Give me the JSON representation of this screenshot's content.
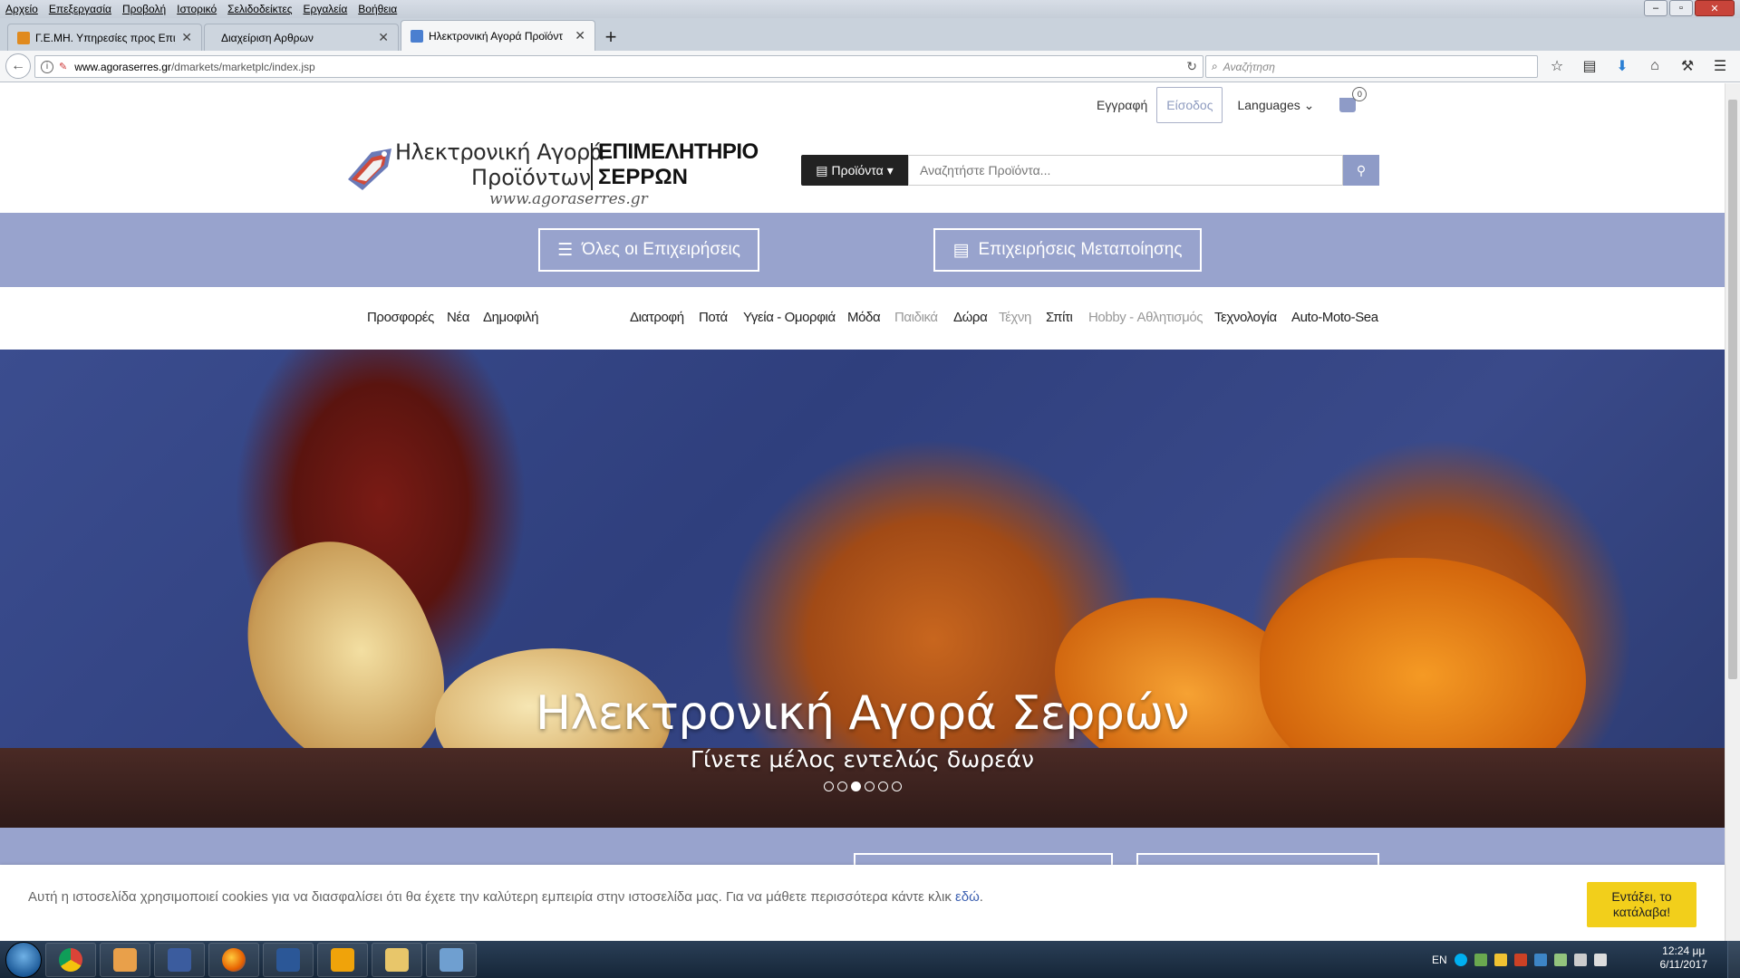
{
  "browser": {
    "menu": [
      "Αρχείο",
      "Επεξεργασία",
      "Προβολή",
      "Ιστορικό",
      "Σελιδοδείκτες",
      "Εργαλεία",
      "Βοήθεια"
    ],
    "tabs": [
      {
        "title": "Γ.Ε.ΜΗ. Υπηρεσίες προς Επιχ",
        "icon_color": "#e08a1e"
      },
      {
        "title": "Διαχείριση Αρθρων",
        "icon_color": ""
      },
      {
        "title": "Ηλεκτρονική Αγορά Προϊόντ",
        "icon_color": "#4a7fd0"
      }
    ],
    "new_tab_label": "+",
    "url_host": "www.agoraserres.gr",
    "url_path": "/dmarkets/marketplc/index.jsp",
    "search_placeholder": "Αναζήτηση"
  },
  "header": {
    "register": "Εγγραφή",
    "login": "Είσοδος",
    "languages": "Languages",
    "cart_count": "0"
  },
  "logo": {
    "line1": "Ηλεκτρονική Αγορά",
    "line2": "Προϊόντων",
    "chamber1": "ΕΠΙΜΕΛΗΤΗΡΙΟ",
    "chamber2": "ΣΕΡΡΩΝ",
    "url": "www.agoraserres.gr"
  },
  "search": {
    "category_label": "Προϊόντα",
    "placeholder": "Αναζητήστε Προϊόντα..."
  },
  "band": {
    "all_businesses": "Όλες οι Επιχειρήσεις",
    "manufacturing": "Επιχειρήσεις Μεταποίησης"
  },
  "categories_left": [
    "Προσφορές",
    "Νέα",
    "Δημοφιλή"
  ],
  "categories_right": [
    "Διατροφή",
    "Ποτά",
    "Υγεία - Ομορφιά",
    "Μόδα",
    "Παιδικά",
    "Δώρα",
    "Τέχνη",
    "Σπίτι",
    "Hobby - Αθλητισμός",
    "Τεχνολογία",
    "Auto-Moto-Sea"
  ],
  "hero": {
    "title": "Ηλεκτρονική Αγορά Σερρών",
    "subtitle": "Γίνετε μέλος εντελώς δωρεάν",
    "slide_count": 6,
    "active_slide": 3
  },
  "cookie": {
    "text": "Αυτή η ιστοσελίδα χρησιμοποιεί cookies για να διασφαλίσει ότι θα έχετε την καλύτερη εμπειρία στην ιστοσελίδα μας. Για να μάθετε περισσότερα κάντε κλικ",
    "link": "εδώ",
    "accept_line1": "Εντάξει, το",
    "accept_line2": "κατάλαβα!"
  },
  "taskbar": {
    "language": "EN",
    "time": "12:24 μμ",
    "date": "6/11/2017"
  },
  "colors": {
    "accent": "#98a3cd",
    "cookie_button": "#f2cf1b"
  }
}
